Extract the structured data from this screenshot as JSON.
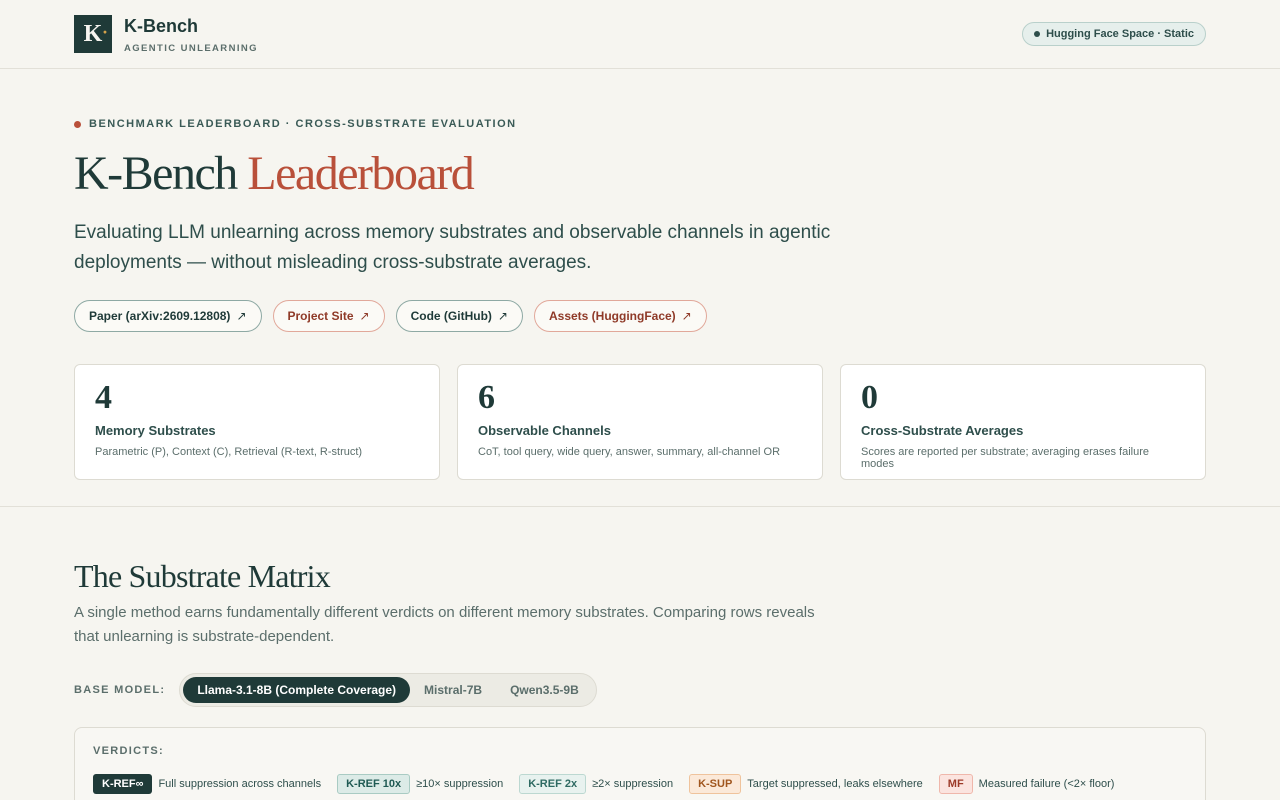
{
  "header": {
    "logo_letter": "K",
    "logo_dot": "·",
    "brand_name": "K-Bench",
    "brand_tag": "AGENTIC UNLEARNING",
    "space_badge": "Hugging Face Space · Static"
  },
  "hero": {
    "eyebrow": "BENCHMARK LEADERBOARD · CROSS-SUBSTRATE EVALUATION",
    "title_main": "K-Bench",
    "title_accent": "Leaderboard",
    "subtitle": "Evaluating LLM unlearning across memory substrates and observable channels in agentic deployments — without misleading cross-substrate averages.",
    "links": [
      {
        "label": "Paper (arXiv:2609.12808)",
        "arrow": "↗"
      },
      {
        "label": "Project Site",
        "arrow": "↗"
      },
      {
        "label": "Code (GitHub)",
        "arrow": "↗"
      },
      {
        "label": "Assets (HuggingFace)",
        "arrow": "↗"
      }
    ],
    "stats": [
      {
        "num": "4",
        "label": "Memory Substrates",
        "desc": "Parametric (P), Context (C), Retrieval (R-text, R-struct)"
      },
      {
        "num": "6",
        "label": "Observable Channels",
        "desc": "CoT, tool query, wide query, answer, summary, all-channel OR"
      },
      {
        "num": "0",
        "label": "Cross-Substrate Averages",
        "desc": "Scores are reported per substrate; averaging erases failure modes"
      }
    ]
  },
  "matrix": {
    "title": "The Substrate Matrix",
    "desc": "A single method earns fundamentally different verdicts on different memory substrates. Comparing rows reveals that unlearning is substrate-dependent.",
    "model_label": "BASE MODEL:",
    "models": [
      "Llama-3.1-8B (Complete Coverage)",
      "Mistral-7B",
      "Qwen3.5-9B"
    ],
    "selected_model": "Llama-3.1-8B (Complete Coverage)",
    "verdicts_title": "VERDICTS:",
    "verdicts": [
      {
        "badge": "K-REF∞",
        "text": "Full suppression across channels"
      },
      {
        "badge": "K-REF 10x",
        "text": "≥10× suppression"
      },
      {
        "badge": "K-REF 2x",
        "text": "≥2× suppression"
      },
      {
        "badge": "K-SUP",
        "text": "Target suppressed, leaks elsewhere"
      },
      {
        "badge": "MF",
        "text": "Measured failure (<2× floor)"
      }
    ]
  },
  "colors": {
    "primary": "#1f3a38",
    "accent": "#b9503a",
    "background": "#f6f5f0"
  }
}
